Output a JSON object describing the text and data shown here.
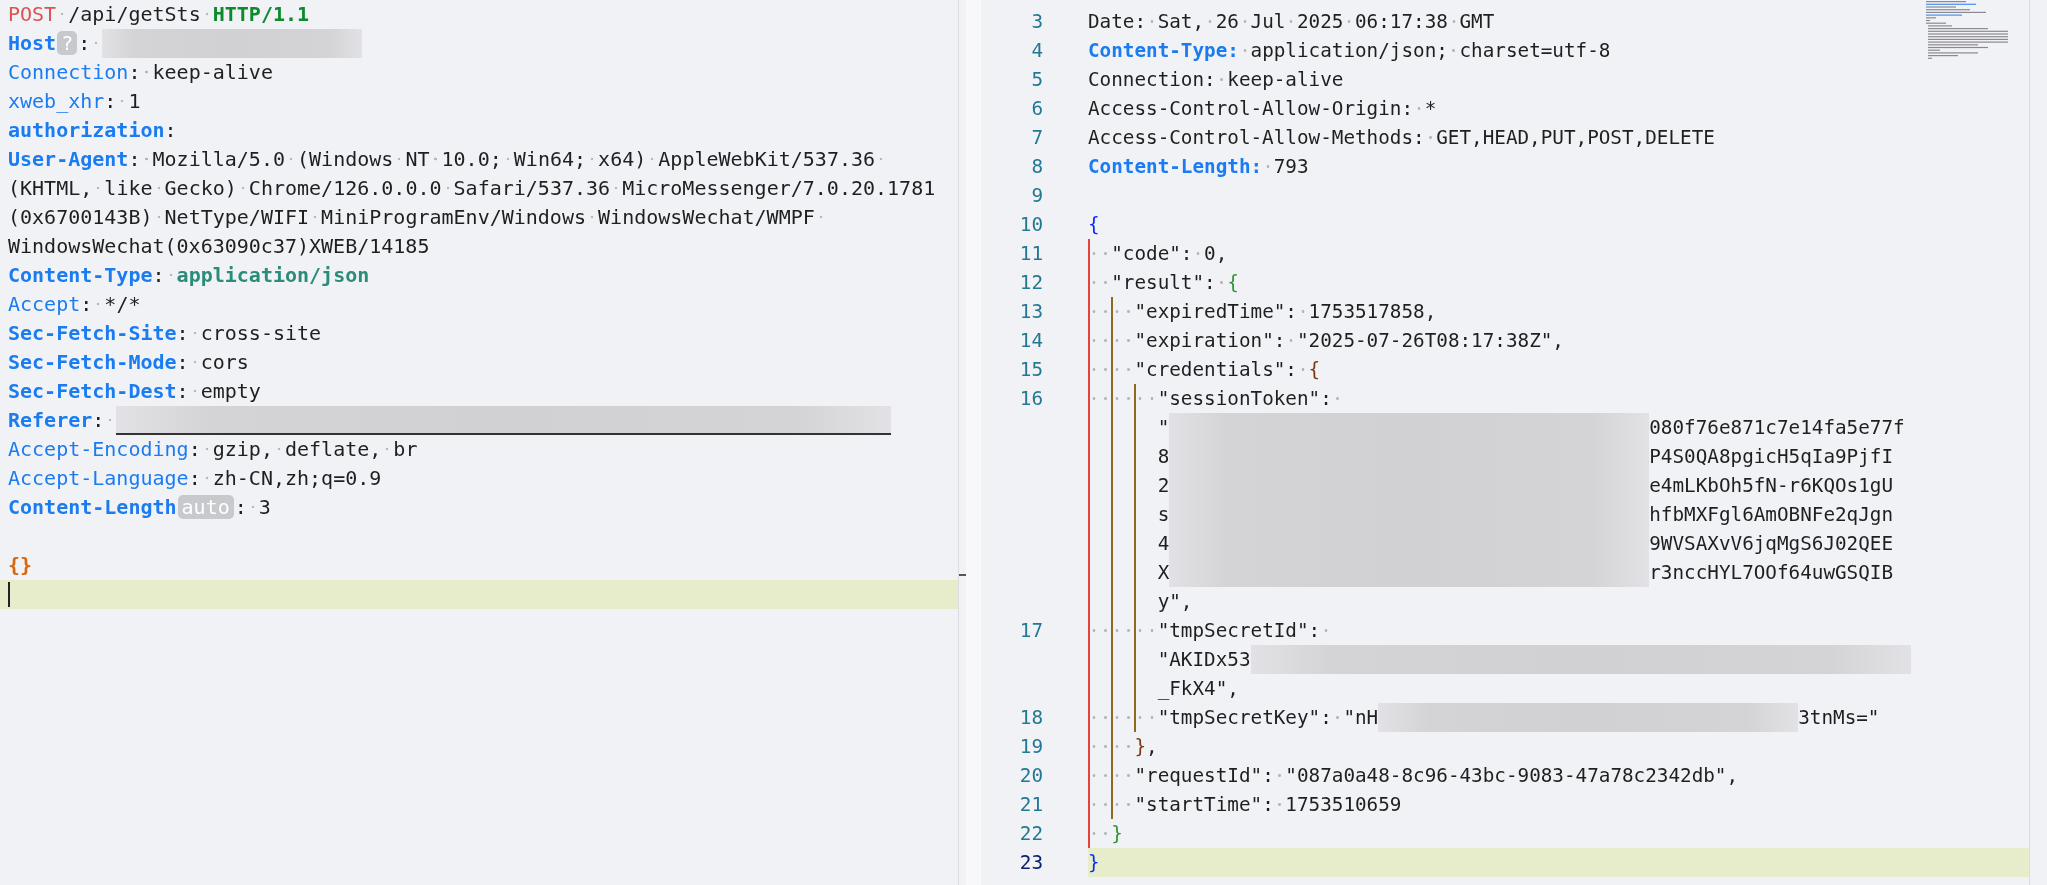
{
  "request": {
    "lines": [
      {
        "current": false,
        "tokens": [
          {
            "kind": "method",
            "text": "POST"
          },
          {
            "kind": "plain",
            "text": " /api/getSts "
          },
          {
            "kind": "version",
            "text": "HTTP/1.1"
          }
        ]
      },
      {
        "current": false,
        "tokens": [
          {
            "kind": "key-bold",
            "text": "Host"
          },
          {
            "kind": "badge",
            "text": "?"
          },
          {
            "kind": "plain",
            "text": ": "
          },
          {
            "kind": "redacted",
            "underlined": false
          }
        ]
      },
      {
        "current": false,
        "tokens": [
          {
            "kind": "key",
            "text": "Connection"
          },
          {
            "kind": "plain",
            "text": ": keep-alive"
          }
        ]
      },
      {
        "current": false,
        "tokens": [
          {
            "kind": "key",
            "text": "xweb_xhr"
          },
          {
            "kind": "plain",
            "text": ": 1"
          }
        ]
      },
      {
        "current": false,
        "tokens": [
          {
            "kind": "key-bold",
            "text": "authorization"
          },
          {
            "kind": "plain",
            "text": ":"
          }
        ]
      },
      {
        "current": false,
        "tokens": [
          {
            "kind": "key-bold",
            "text": "User-Agent"
          },
          {
            "kind": "plain",
            "text": ": Mozilla/5.0 (Windows NT 10.0; Win64; x64) AppleWebKit/537.36 "
          }
        ]
      },
      {
        "current": false,
        "tokens": [
          {
            "kind": "plain",
            "text": "(KHTML, like Gecko) Chrome/126.0.0.0 Safari/537.36 MicroMessenger/7.0.20.1781"
          }
        ]
      },
      {
        "current": false,
        "tokens": [
          {
            "kind": "plain",
            "text": "(0x6700143B) NetType/WIFI MiniProgramEnv/Windows WindowsWechat/WMPF "
          }
        ]
      },
      {
        "current": false,
        "tokens": [
          {
            "kind": "plain",
            "text": "WindowsWechat(0x63090c37)XWEB/14185"
          }
        ]
      },
      {
        "current": false,
        "tokens": [
          {
            "kind": "key-bold",
            "text": "Content-Type"
          },
          {
            "kind": "plain",
            "text": ": "
          },
          {
            "kind": "value-bold",
            "text": "application/json"
          }
        ]
      },
      {
        "current": false,
        "tokens": [
          {
            "kind": "key",
            "text": "Accept"
          },
          {
            "kind": "plain",
            "text": ": */*"
          }
        ]
      },
      {
        "current": false,
        "tokens": [
          {
            "kind": "key-bold",
            "text": "Sec-Fetch-Site"
          },
          {
            "kind": "plain",
            "text": ": cross-site"
          }
        ]
      },
      {
        "current": false,
        "tokens": [
          {
            "kind": "key-bold",
            "text": "Sec-Fetch-Mode"
          },
          {
            "kind": "plain",
            "text": ": cors"
          }
        ]
      },
      {
        "current": false,
        "tokens": [
          {
            "kind": "key-bold",
            "text": "Sec-Fetch-Dest"
          },
          {
            "kind": "plain",
            "text": ": empty"
          }
        ]
      },
      {
        "current": false,
        "tokens": [
          {
            "kind": "key-bold",
            "text": "Referer"
          },
          {
            "kind": "plain",
            "text": ": "
          },
          {
            "kind": "redacted",
            "underlined": true
          }
        ]
      },
      {
        "current": false,
        "tokens": [
          {
            "kind": "key",
            "text": "Accept-Encoding"
          },
          {
            "kind": "plain",
            "text": ": gzip, deflate, br"
          }
        ]
      },
      {
        "current": false,
        "tokens": [
          {
            "kind": "key",
            "text": "Accept-Language"
          },
          {
            "kind": "plain",
            "text": ": zh-CN,zh;q=0.9"
          }
        ]
      },
      {
        "current": false,
        "tokens": [
          {
            "kind": "key-bold",
            "text": "Content-Length"
          },
          {
            "kind": "badge",
            "text": "auto"
          },
          {
            "kind": "plain",
            "text": ": 3"
          }
        ]
      },
      {
        "current": false
      },
      {
        "current": false,
        "tokens": [
          {
            "kind": "brace-orange",
            "text": "{}"
          }
        ]
      },
      {
        "current": true
      }
    ]
  },
  "response": {
    "lines": [
      {
        "number": "3",
        "current": false,
        "tokens": [
          {
            "kind": "plain",
            "text": "Date: Sat, 26 Jul 2025 06:17:38 GMT"
          }
        ]
      },
      {
        "number": "4",
        "current": false,
        "tokens": [
          {
            "kind": "key-bold",
            "text": "Content-Type:"
          },
          {
            "kind": "plain",
            "text": " application/json; charset=utf-8"
          }
        ]
      },
      {
        "number": "5",
        "current": false,
        "tokens": [
          {
            "kind": "plain",
            "text": "Connection: keep-alive"
          }
        ]
      },
      {
        "number": "6",
        "current": false,
        "tokens": [
          {
            "kind": "plain",
            "text": "Access-Control-Allow-Origin: *"
          }
        ]
      },
      {
        "number": "7",
        "current": false,
        "tokens": [
          {
            "kind": "plain",
            "text": "Access-Control-Allow-Methods: GET,HEAD,PUT,POST,DELETE"
          }
        ]
      },
      {
        "number": "8",
        "current": false,
        "tokens": [
          {
            "kind": "key-bold",
            "text": "Content-Length:"
          },
          {
            "kind": "plain",
            "text": " 793"
          }
        ]
      },
      {
        "number": "9",
        "current": false
      },
      {
        "number": "10",
        "current": false,
        "tokens": [
          {
            "kind": "brace-1",
            "text": "{"
          }
        ]
      },
      {
        "number": "11",
        "current": false,
        "tokens": [
          {
            "kind": "plain",
            "text": "  \"code\": 0,"
          }
        ]
      },
      {
        "number": "12",
        "current": false,
        "tokens": [
          {
            "kind": "plain",
            "text": "  \"result\": "
          },
          {
            "kind": "brace-2",
            "text": "{"
          }
        ]
      },
      {
        "number": "13",
        "current": false,
        "tokens": [
          {
            "kind": "plain",
            "text": "    \"expiredTime\": 1753517858,"
          }
        ]
      },
      {
        "number": "14",
        "current": false,
        "tokens": [
          {
            "kind": "plain",
            "text": "    \"expiration\": \"2025-07-26T08:17:38Z\","
          }
        ]
      },
      {
        "number": "15",
        "current": false,
        "tokens": [
          {
            "kind": "plain",
            "text": "    \"credentials\": "
          },
          {
            "kind": "brace-3",
            "text": "{"
          }
        ]
      },
      {
        "number": "16",
        "current": false,
        "tokens": [
          {
            "kind": "plain",
            "text": "      \"sessionToken\": "
          }
        ]
      },
      {
        "current": false,
        "tokens": [
          {
            "kind": "plain",
            "text": "      \""
          },
          {
            "kind": "redacted",
            "underlined": false
          },
          {
            "kind": "plain",
            "text": "080f76e871c7e14fa5e77f"
          }
        ]
      },
      {
        "current": false,
        "tokens": [
          {
            "kind": "plain",
            "text": "      8"
          },
          {
            "kind": "redacted",
            "underlined": false
          },
          {
            "kind": "plain",
            "text": "P4S0QA8pgicH5qIa9PjfI"
          }
        ]
      },
      {
        "current": false,
        "tokens": [
          {
            "kind": "plain",
            "text": "      2"
          },
          {
            "kind": "redacted",
            "underlined": false
          },
          {
            "kind": "plain",
            "text": "e4mLKbOh5fN-r6KQOs1gU"
          }
        ]
      },
      {
        "current": false,
        "tokens": [
          {
            "kind": "plain",
            "text": "      s"
          },
          {
            "kind": "redacted",
            "underlined": false
          },
          {
            "kind": "plain",
            "text": "hfbMXFgl6AmOBNFe2qJgn"
          }
        ]
      },
      {
        "current": false,
        "tokens": [
          {
            "kind": "plain",
            "text": "      4"
          },
          {
            "kind": "redacted",
            "underlined": false
          },
          {
            "kind": "plain",
            "text": "9WVSAXvV6jqMgS6J02QEE"
          }
        ]
      },
      {
        "current": false,
        "tokens": [
          {
            "kind": "plain",
            "text": "      X"
          },
          {
            "kind": "redacted",
            "underlined": false
          },
          {
            "kind": "plain",
            "text": "r3nccHYL7OOf64uwGSQIB"
          }
        ]
      },
      {
        "current": false,
        "tokens": [
          {
            "kind": "plain",
            "text": "      y\","
          }
        ]
      },
      {
        "number": "17",
        "current": false,
        "tokens": [
          {
            "kind": "plain",
            "text": "      \"tmpSecretId\": "
          }
        ]
      },
      {
        "current": false,
        "tokens": [
          {
            "kind": "plain",
            "text": "      \"AKIDx53"
          },
          {
            "kind": "redacted",
            "underlined": false
          }
        ]
      },
      {
        "current": false,
        "tokens": [
          {
            "kind": "plain",
            "text": "      _FkX4\","
          }
        ]
      },
      {
        "number": "18",
        "current": false,
        "tokens": [
          {
            "kind": "plain",
            "text": "      \"tmpSecretKey\": \"nH"
          },
          {
            "kind": "redacted",
            "underlined": false
          },
          {
            "kind": "plain",
            "text": "3tnMs=\""
          }
        ]
      },
      {
        "number": "19",
        "current": false,
        "tokens": [
          {
            "kind": "brace-3",
            "text": "    }"
          },
          {
            "kind": "plain",
            "text": ","
          }
        ]
      },
      {
        "number": "20",
        "current": false,
        "tokens": [
          {
            "kind": "plain",
            "text": "    \"requestId\": \"087a0a48-8c96-43bc-9083-47a78c2342db\","
          }
        ]
      },
      {
        "number": "21",
        "current": false,
        "tokens": [
          {
            "kind": "plain",
            "text": "    \"startTime\": 1753510659"
          }
        ]
      },
      {
        "number": "22",
        "current": false,
        "tokens": [
          {
            "kind": "brace-2",
            "text": "  }"
          }
        ]
      },
      {
        "number": "23",
        "current": true,
        "tokens": [
          {
            "kind": "brace-1",
            "text": "}"
          }
        ]
      }
    ]
  }
}
